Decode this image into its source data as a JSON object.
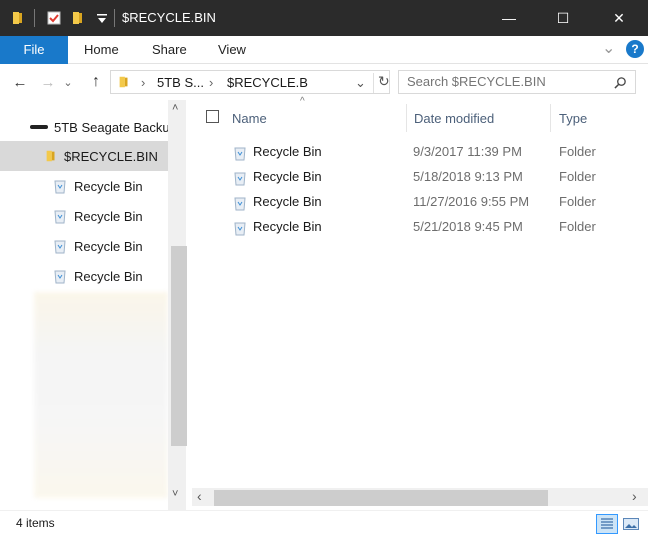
{
  "window": {
    "title": "$RECYCLE.BIN",
    "minimize_glyph": "—",
    "maximize_glyph": "☐",
    "close_glyph": "✕"
  },
  "ribbon": {
    "tabs": [
      {
        "label": "File"
      },
      {
        "label": "Home"
      },
      {
        "label": "Share"
      },
      {
        "label": "View"
      }
    ],
    "help_glyph": "?",
    "expand_glyph": "⌄"
  },
  "address": {
    "back_glyph": "←",
    "forward_glyph": "→",
    "recent_glyph": "⌄",
    "up_glyph": "↑",
    "crumb_sep": "›",
    "crumbs": [
      "5TB S...",
      "$RECYCLE.B"
    ],
    "dropdown_glyph": "⌄",
    "refresh_glyph": "↻"
  },
  "search": {
    "placeholder": "Search $RECYCLE.BIN",
    "icon": "search-icon"
  },
  "nav": {
    "items": [
      {
        "label": "5TB Seagate Backu",
        "icon": "drive-icon"
      },
      {
        "label": "$RECYCLE.BIN",
        "icon": "folder-icon",
        "selected": true
      },
      {
        "label": "Recycle Bin",
        "icon": "recycle-bin-icon"
      },
      {
        "label": "Recycle Bin",
        "icon": "recycle-bin-icon"
      },
      {
        "label": "Recycle Bin",
        "icon": "recycle-bin-icon"
      },
      {
        "label": "Recycle Bin",
        "icon": "recycle-bin-icon"
      }
    ],
    "scroll_up_glyph": "˄",
    "scroll_down_glyph": "˅"
  },
  "files": {
    "columns": [
      "Name",
      "Date modified",
      "Type"
    ],
    "sort_glyph": "^",
    "rows": [
      {
        "name": "Recycle Bin",
        "date": "9/3/2017 11:39 PM",
        "type": "Folder"
      },
      {
        "name": "Recycle Bin",
        "date": "5/18/2018 9:13 PM",
        "type": "Folder"
      },
      {
        "name": "Recycle Bin",
        "date": "11/27/2016 9:55 PM",
        "type": "Folder"
      },
      {
        "name": "Recycle Bin",
        "date": "5/21/2018 9:45 PM",
        "type": "Folder"
      }
    ],
    "scroll_left_glyph": "‹",
    "scroll_right_glyph": "›"
  },
  "status": {
    "item_count": "4 items"
  },
  "colors": {
    "titlebar": "#2b2b2b",
    "file_tab": "#1979ca",
    "selected_nav": "#d9d9d9",
    "folder_yellow": "#f3c94a"
  }
}
